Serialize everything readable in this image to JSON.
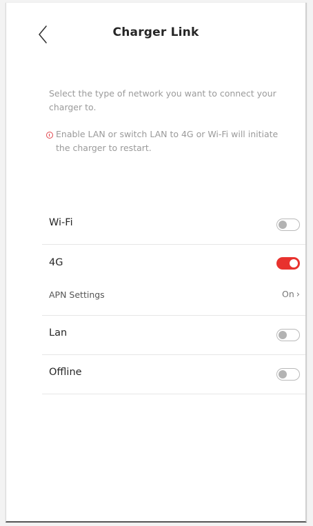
{
  "header": {
    "title": "Charger Link",
    "back_icon": "chevron-left-icon"
  },
  "description": "Select the type of network you want to connect your charger to.",
  "warning": {
    "icon": "alert-circle-icon",
    "text": "Enable LAN or switch LAN to 4G or Wi-Fi will initiate the charger to restart.",
    "color": "#e0424a"
  },
  "networks": [
    {
      "label": "Wi-Fi",
      "enabled": false
    },
    {
      "label": "4G",
      "enabled": true
    },
    {
      "label": "Lan",
      "enabled": false
    },
    {
      "label": "Offline",
      "enabled": false
    }
  ],
  "apn": {
    "label": "APN Settings",
    "value": "On",
    "chevron": "›"
  },
  "colors": {
    "toggle_on": "#e8322e",
    "toggle_off": "#b3b3b3"
  }
}
